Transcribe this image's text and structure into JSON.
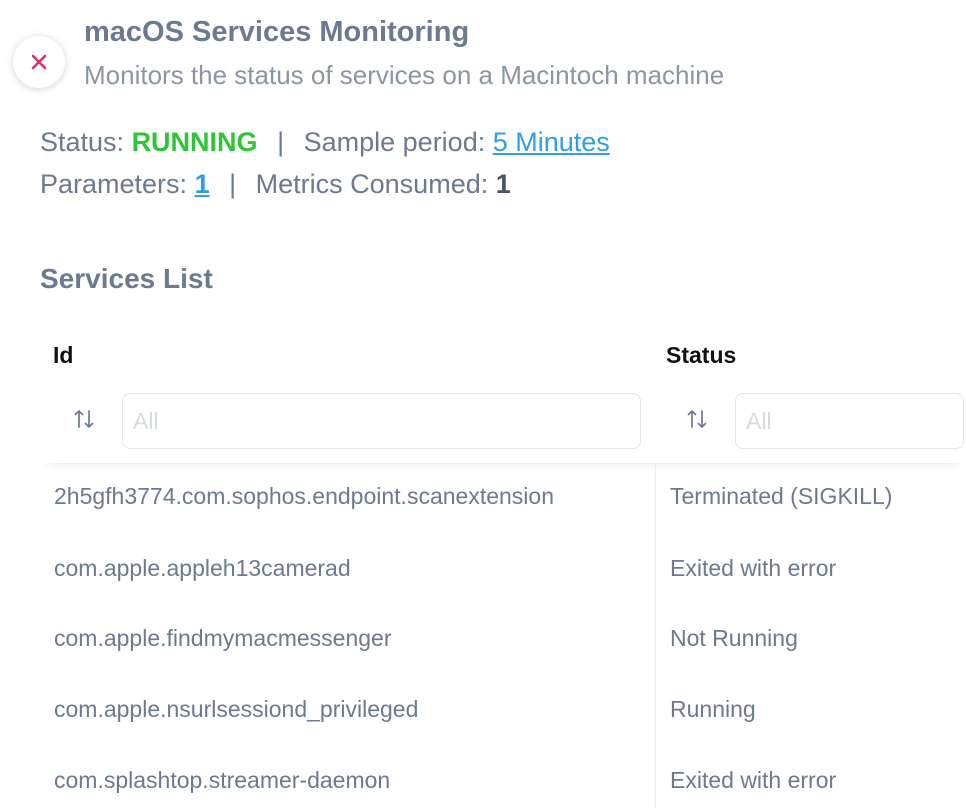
{
  "header": {
    "title": "macOS Services Monitoring",
    "subtitle": "Monitors the status of services on a Macintoch machine"
  },
  "info": {
    "status_label": "Status:",
    "status_value": "RUNNING",
    "separator": "|",
    "sample_period_label": "Sample period:",
    "sample_period_value": "5 Minutes",
    "parameters_label": "Parameters:",
    "parameters_value": "1",
    "metrics_label": "Metrics Consumed:",
    "metrics_value": "1"
  },
  "services": {
    "section_title": "Services List",
    "columns": [
      {
        "title": "Id",
        "filter_placeholder": "All"
      },
      {
        "title": "Status",
        "filter_placeholder": "All"
      }
    ],
    "rows": [
      {
        "id": "2h5gfh3774.com.sophos.endpoint.scanextension",
        "status": "Terminated (SIGKILL)"
      },
      {
        "id": "com.apple.appleh13camerad",
        "status": "Exited with error"
      },
      {
        "id": "com.apple.findmymacmessenger",
        "status": "Not Running"
      },
      {
        "id": "com.apple.nsurlsessiond_privileged",
        "status": "Running"
      },
      {
        "id": "com.splashtop.streamer-daemon",
        "status": "Exited with error"
      }
    ]
  },
  "colors": {
    "text": "#6b7a90",
    "running_green": "#2ec637",
    "link_blue": "#2f9ee6",
    "close_pink": "#d6336c"
  },
  "icons": {
    "close": "close-icon",
    "sort": "sort-arrows-icon"
  }
}
